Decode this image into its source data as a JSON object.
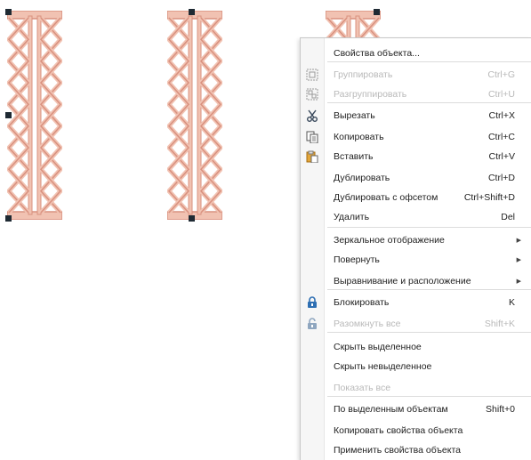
{
  "canvas": {
    "objects": [
      {
        "name": "embroidery-object-1"
      },
      {
        "name": "embroidery-object-2"
      },
      {
        "name": "embroidery-object-3"
      }
    ],
    "stitch_color": "#d9917f",
    "stitch_color_light": "#f1c2b2",
    "handle_color": "#1f2a33"
  },
  "context_menu": {
    "items": [
      {
        "label": "Свойства объекта...",
        "shortcut": "",
        "icon": "",
        "disabled": false
      },
      {
        "label": "Группировать",
        "shortcut": "Ctrl+G",
        "icon": "group-icon",
        "disabled": true
      },
      {
        "label": "Разгруппировать",
        "shortcut": "Ctrl+U",
        "icon": "ungroup-icon",
        "disabled": true
      },
      {
        "label": "Вырезать",
        "shortcut": "Ctrl+X",
        "icon": "scissors-icon",
        "disabled": false
      },
      {
        "label": "Копировать",
        "shortcut": "Ctrl+C",
        "icon": "copy-icon",
        "disabled": false
      },
      {
        "label": "Вставить",
        "shortcut": "Ctrl+V",
        "icon": "paste-icon",
        "disabled": false
      },
      {
        "label": "Дублировать",
        "shortcut": "Ctrl+D",
        "icon": "",
        "disabled": false
      },
      {
        "label": "Дублировать с офсетом",
        "shortcut": "Ctrl+Shift+D",
        "icon": "",
        "disabled": false
      },
      {
        "label": "Удалить",
        "shortcut": "Del",
        "icon": "",
        "disabled": false
      },
      {
        "label": "Зеркальное отображение",
        "shortcut": "",
        "icon": "",
        "disabled": false,
        "submenu": true
      },
      {
        "label": "Повернуть",
        "shortcut": "",
        "icon": "",
        "disabled": false,
        "submenu": true
      },
      {
        "label": "Выравнивание и расположение",
        "shortcut": "",
        "icon": "",
        "disabled": false,
        "submenu": true
      },
      {
        "label": "Блокировать",
        "shortcut": "K",
        "icon": "lock-icon",
        "disabled": false
      },
      {
        "label": "Разомкнуть все",
        "shortcut": "Shift+K",
        "icon": "unlock-icon",
        "disabled": true
      },
      {
        "label": "Скрыть выделенное",
        "shortcut": "",
        "icon": "",
        "disabled": false
      },
      {
        "label": "Скрыть невыделенное",
        "shortcut": "",
        "icon": "",
        "disabled": false
      },
      {
        "label": "Показать все",
        "shortcut": "",
        "icon": "",
        "disabled": true
      },
      {
        "label": "По выделенным объектам",
        "shortcut": "Shift+0",
        "icon": "",
        "disabled": false
      },
      {
        "label": "Копировать свойства объекта",
        "shortcut": "",
        "icon": "",
        "disabled": false
      },
      {
        "label": "Применить свойства объекта",
        "shortcut": "",
        "icon": "",
        "disabled": false
      }
    ]
  }
}
